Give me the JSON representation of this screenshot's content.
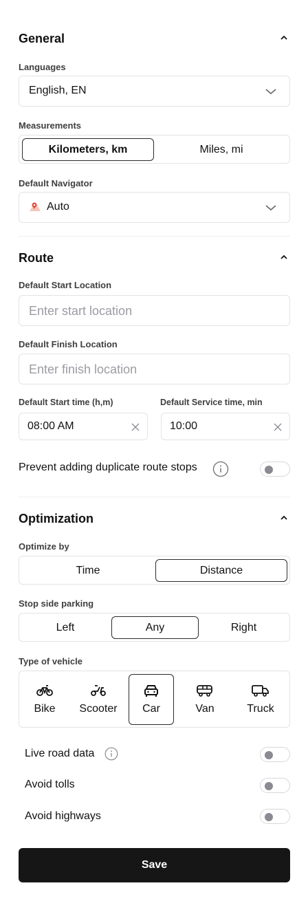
{
  "general": {
    "title": "General",
    "languages": {
      "label": "Languages",
      "value": "English, EN"
    },
    "measurements": {
      "label": "Measurements",
      "options": [
        "Kilometers, km",
        "Miles, mi"
      ],
      "selected": "Kilometers, km"
    },
    "navigator": {
      "label": "Default Navigator",
      "value": "Auto",
      "icon": "maps-pin-icon"
    }
  },
  "route": {
    "title": "Route",
    "start_location": {
      "label": "Default Start Location",
      "placeholder": "Enter start location"
    },
    "finish_location": {
      "label": "Default Finish Location",
      "placeholder": "Enter finish location"
    },
    "start_time": {
      "label": "Default Start time (h,m)",
      "value": "08:00 AM"
    },
    "service_time": {
      "label": "Default Service time, min",
      "value": "10:00"
    },
    "prevent_duplicates": {
      "label": "Prevent adding duplicate route stops",
      "enabled": false
    }
  },
  "optimization": {
    "title": "Optimization",
    "optimize_by": {
      "label": "Optimize by",
      "options": [
        "Time",
        "Distance"
      ],
      "selected": "Distance"
    },
    "stop_side": {
      "label": "Stop side parking",
      "options": [
        "Left",
        "Any",
        "Right"
      ],
      "selected": "Any"
    },
    "vehicle": {
      "label": "Type of vehicle",
      "options": [
        {
          "label": "Bike",
          "icon": "bike-icon"
        },
        {
          "label": "Scooter",
          "icon": "scooter-icon"
        },
        {
          "label": "Car",
          "icon": "car-icon"
        },
        {
          "label": "Van",
          "icon": "van-icon"
        },
        {
          "label": "Truck",
          "icon": "truck-icon"
        }
      ],
      "selected": "Car"
    },
    "live_road_data": {
      "label": "Live road data",
      "enabled": false
    },
    "avoid_tolls": {
      "label": "Avoid tolls",
      "enabled": false
    },
    "avoid_highways": {
      "label": "Avoid highways",
      "enabled": false
    }
  },
  "save_label": "Save",
  "colors": {
    "primary_button": "#161616",
    "border": "#e3e3e6",
    "placeholder": "#9b9ba3"
  }
}
